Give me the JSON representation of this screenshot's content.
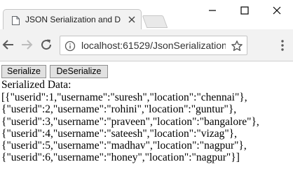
{
  "browser": {
    "tab_title": "JSON Serialization and D",
    "url": "localhost:61529/JsonSerialization["
  },
  "page": {
    "serialize_label": "Serialize",
    "deserialize_label": "DeSerialize",
    "heading": "Serialized Data:",
    "lines": [
      "[{\"userid\":1,\"username\":\"suresh\",\"location\":\"chennai\"},",
      "{\"userid\":2,\"username\":\"rohini\",\"location\":\"guntur\"},",
      "{\"userid\":3,\"username\":\"praveen\",\"location\":\"bangalore\"},",
      "{\"userid\":4,\"username\":\"sateesh\",\"location\":\"vizag\"},",
      "{\"userid\":5,\"username\":\"madhav\",\"location\":\"nagpur\"},",
      "{\"userid\":6,\"username\":\"honey\",\"location\":\"nagpur\"}]"
    ]
  },
  "icons": {
    "tab_favicon": "page-icon",
    "tab_close": "close-icon",
    "back": "arrow-left-icon",
    "forward": "arrow-right-icon",
    "reload": "reload-icon",
    "info": "info-icon",
    "star": "star-icon",
    "menu": "kebab-menu-icon",
    "minimize": "minimize-icon",
    "maximize": "maximize-icon",
    "window_close": "close-icon"
  }
}
